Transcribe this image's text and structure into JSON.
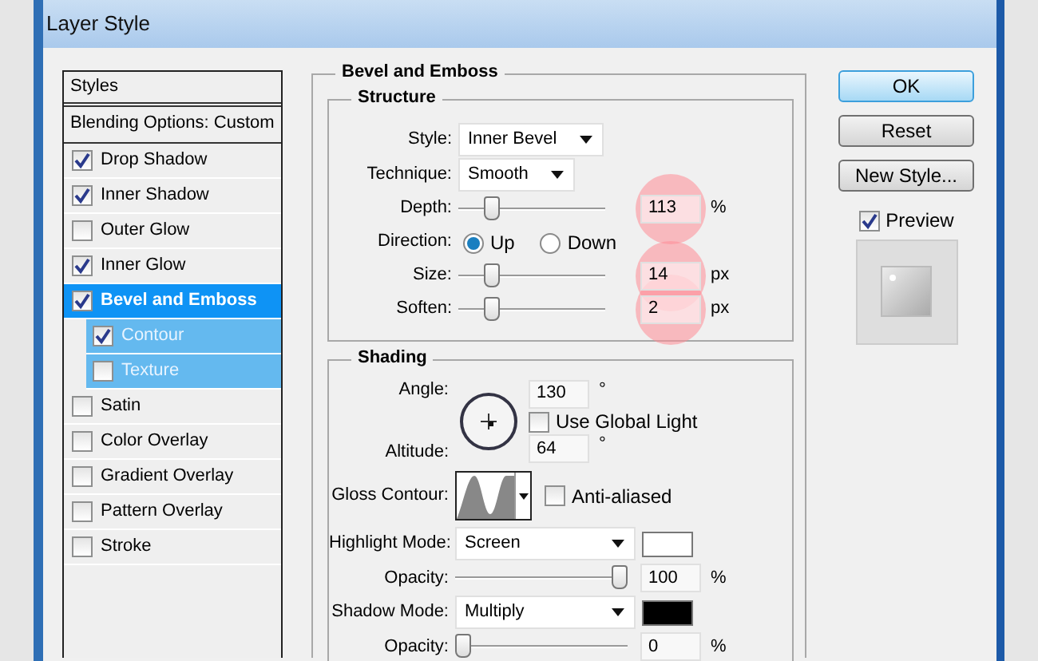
{
  "window": {
    "title": "Layer Style"
  },
  "styles_panel": {
    "header": "Styles",
    "blending": "Blending Options: Custom",
    "items": [
      {
        "label": "Drop Shadow",
        "checked": true,
        "selected": false
      },
      {
        "label": "Inner Shadow",
        "checked": true,
        "selected": false
      },
      {
        "label": "Outer Glow",
        "checked": false,
        "selected": false
      },
      {
        "label": "Inner Glow",
        "checked": true,
        "selected": false
      },
      {
        "label": "Bevel and Emboss",
        "checked": true,
        "selected": true,
        "children": [
          {
            "label": "Contour",
            "checked": true
          },
          {
            "label": "Texture",
            "checked": false
          }
        ]
      },
      {
        "label": "Satin",
        "checked": false,
        "selected": false
      },
      {
        "label": "Color Overlay",
        "checked": false,
        "selected": false
      },
      {
        "label": "Gradient Overlay",
        "checked": false,
        "selected": false
      },
      {
        "label": "Pattern Overlay",
        "checked": false,
        "selected": false
      },
      {
        "label": "Stroke",
        "checked": false,
        "selected": false
      }
    ]
  },
  "bevel_emboss": {
    "title": "Bevel and Emboss",
    "structure": {
      "title": "Structure",
      "rows": [
        {
          "kind": "select",
          "label": "Style:",
          "value": "Inner Bevel"
        },
        {
          "kind": "select",
          "label": "Technique:",
          "value": "Smooth"
        },
        {
          "kind": "slider",
          "label": "Depth:",
          "level": 0.2,
          "value": "113",
          "unit": "%",
          "highlighted": true
        },
        {
          "kind": "radio",
          "label": "Direction:",
          "options": [
            {
              "label": "Up",
              "selected": true
            },
            {
              "label": "Down",
              "selected": false
            }
          ]
        },
        {
          "kind": "slider",
          "label": "Size:",
          "level": 0.2,
          "value": "14",
          "unit": "px",
          "highlighted": true
        },
        {
          "kind": "slider",
          "label": "Soften:",
          "level": 0.2,
          "value": "2",
          "unit": "px",
          "highlighted": true
        }
      ]
    },
    "shading": {
      "title": "Shading",
      "rows": [
        {
          "kind": "angle",
          "label": "Angle:",
          "value": "130",
          "unit": "°",
          "option": {
            "label": "Use Global Light",
            "checked": false
          },
          "altitude": {
            "label": "Altitude:",
            "value": "64",
            "unit": "°"
          }
        },
        {
          "kind": "contour",
          "label": "Gloss Contour:",
          "option": {
            "label": "Anti-aliased",
            "checked": false
          }
        },
        {
          "kind": "select",
          "label": "Highlight Mode:",
          "value": "Screen",
          "color": "#ffffff"
        },
        {
          "kind": "slider",
          "label": "Opacity:",
          "level": 1,
          "value": "100",
          "unit": "%"
        },
        {
          "kind": "select",
          "label": "Shadow Mode:",
          "value": "Multiply",
          "color": "#000000"
        },
        {
          "kind": "slider",
          "label": "Opacity:",
          "level": 0,
          "value": "0",
          "unit": "%"
        }
      ]
    }
  },
  "buttons": [
    {
      "label": "OK",
      "default": true
    },
    {
      "label": "Reset",
      "default": false
    },
    {
      "label": "New Style...",
      "default": false
    }
  ],
  "preview": {
    "label": "Preview",
    "checked": true
  }
}
